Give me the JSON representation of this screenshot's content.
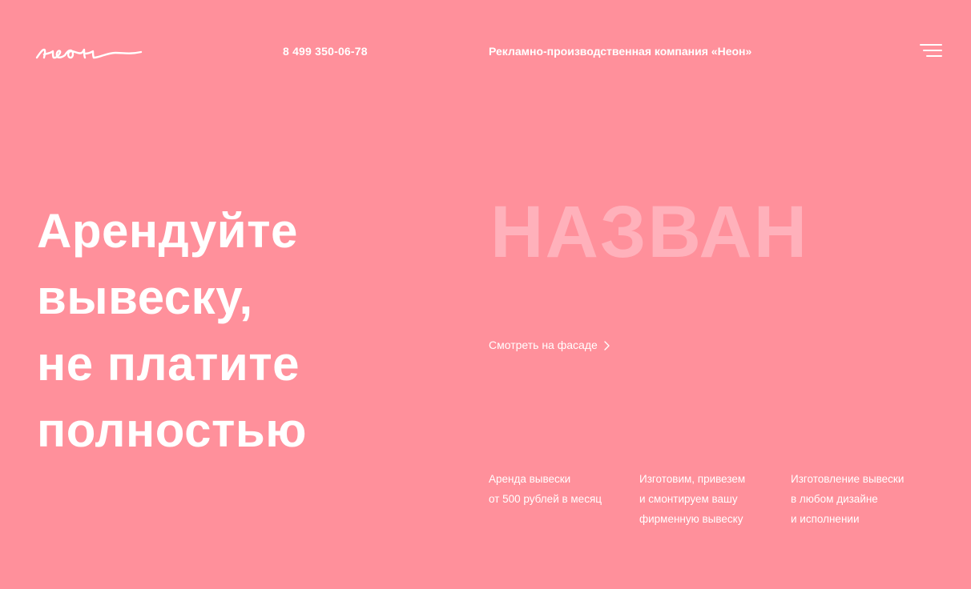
{
  "header": {
    "logo_text": "неон",
    "phone": "8 499 350-06-78",
    "company": "Рекламно-производственная компания «Неон»",
    "menu_icon": "hamburger-menu-icon"
  },
  "hero": {
    "title_lines": [
      "Арендуйте",
      "вывеску,",
      "не платите",
      "полностью"
    ],
    "preview_word": "НАЗВАН",
    "facade_link": "Смотреть на фасаде",
    "facade_icon": "chevron-right-icon"
  },
  "features": [
    {
      "lines": [
        "Аренда вывески",
        "от 500 рублей в месяц"
      ]
    },
    {
      "lines": [
        "Изготовим, привезем",
        "и смонтируем вашу",
        "фирменную вывеску"
      ]
    },
    {
      "lines": [
        "Изготовление вывески",
        "в любом дизайне",
        "и исполнении"
      ]
    }
  ],
  "colors": {
    "background": "#ff909b",
    "text": "#ffffff",
    "preview_word": "#ffb1bb"
  }
}
